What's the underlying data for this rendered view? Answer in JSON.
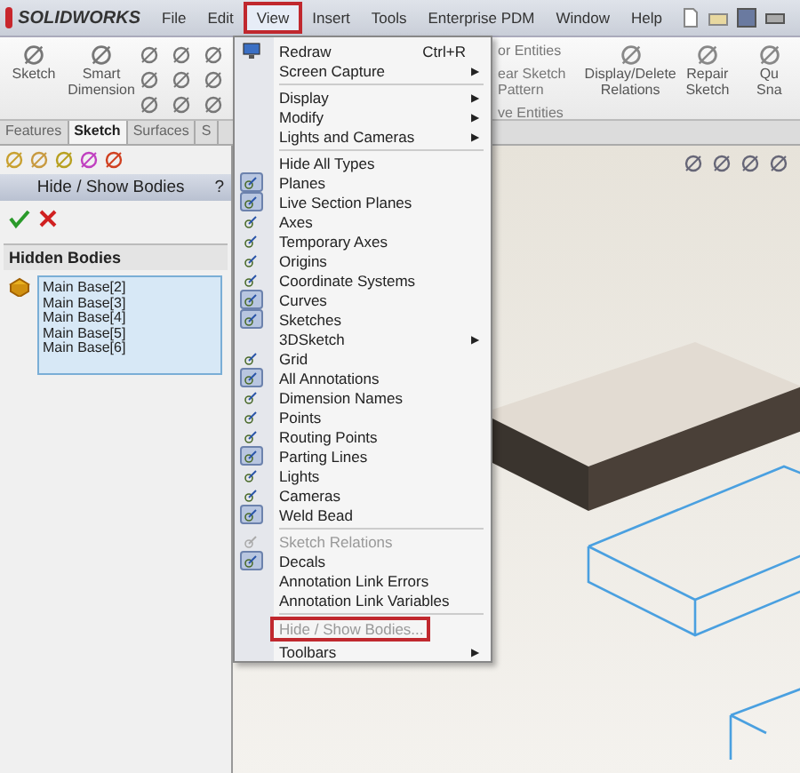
{
  "app": {
    "logo": "SOLIDWORKS"
  },
  "menubar": [
    {
      "label": "File",
      "selected": false
    },
    {
      "label": "Edit",
      "selected": false
    },
    {
      "label": "View",
      "selected": true
    },
    {
      "label": "Insert",
      "selected": false
    },
    {
      "label": "Tools",
      "selected": false
    },
    {
      "label": "Enterprise PDM",
      "selected": false
    },
    {
      "label": "Window",
      "selected": false
    },
    {
      "label": "Help",
      "selected": false
    }
  ],
  "ribbon": {
    "left": [
      {
        "label": "Sketch"
      },
      {
        "label": "Smart Dimension"
      }
    ],
    "partial": [
      "or Entities",
      "ear Sketch Pattern",
      "ve Entities"
    ],
    "right": [
      {
        "label": "Display/Delete Relations"
      },
      {
        "label": "Repair Sketch"
      },
      {
        "label": "Qu Sna"
      }
    ]
  },
  "tabs": [
    {
      "label": "Features",
      "selected": false
    },
    {
      "label": "Sketch",
      "selected": true
    },
    {
      "label": "Surfaces",
      "selected": false
    },
    {
      "label": "S",
      "selected": false
    }
  ],
  "property_manager": {
    "title": "Hide / Show Bodies",
    "help": "?",
    "group": {
      "title": "Hidden Bodies",
      "bodies": [
        "Main Base[2]",
        "Main Base[3]",
        "Main Base[4]",
        "Main Base[5]",
        "Main Base[6]"
      ]
    }
  },
  "view_menu": [
    {
      "kind": "icon_command",
      "label": "Redraw",
      "shortcut": "Ctrl+R"
    },
    {
      "kind": "submenu",
      "label": "Screen Capture",
      "arrow": "▶"
    },
    {
      "kind": "separator"
    },
    {
      "kind": "submenu",
      "label": "Display",
      "arrow": "▶"
    },
    {
      "kind": "submenu",
      "label": "Modify",
      "arrow": "▶"
    },
    {
      "kind": "submenu",
      "label": "Lights and Cameras",
      "arrow": "▶"
    },
    {
      "kind": "separator"
    },
    {
      "kind": "command",
      "label": "Hide All Types",
      "disabled": false
    },
    {
      "kind": "toggle",
      "label": "Planes",
      "checked": true,
      "disabled": false
    },
    {
      "kind": "toggle",
      "label": "Live Section Planes",
      "checked": true,
      "disabled": false
    },
    {
      "kind": "toggle",
      "label": "Axes",
      "checked": false,
      "disabled": false
    },
    {
      "kind": "toggle",
      "label": "Temporary Axes",
      "checked": false,
      "disabled": false
    },
    {
      "kind": "toggle",
      "label": "Origins",
      "checked": false,
      "disabled": false
    },
    {
      "kind": "toggle",
      "label": "Coordinate Systems",
      "checked": false,
      "disabled": false
    },
    {
      "kind": "toggle",
      "label": "Curves",
      "checked": true,
      "disabled": false
    },
    {
      "kind": "toggle",
      "label": "Sketches",
      "checked": true,
      "disabled": false
    },
    {
      "kind": "submenu",
      "label": "3DSketch",
      "arrow": "▶"
    },
    {
      "kind": "toggle",
      "label": "Grid",
      "checked": false,
      "disabled": false
    },
    {
      "kind": "toggle",
      "label": "All Annotations",
      "checked": true,
      "disabled": false
    },
    {
      "kind": "toggle",
      "label": "Dimension Names",
      "checked": false,
      "disabled": false
    },
    {
      "kind": "toggle",
      "label": "Points",
      "checked": false,
      "disabled": false
    },
    {
      "kind": "toggle",
      "label": "Routing Points",
      "checked": false,
      "disabled": false
    },
    {
      "kind": "toggle",
      "label": "Parting Lines",
      "checked": true,
      "disabled": false
    },
    {
      "kind": "toggle",
      "label": "Lights",
      "checked": false,
      "disabled": false
    },
    {
      "kind": "toggle",
      "label": "Cameras",
      "checked": false,
      "disabled": false
    },
    {
      "kind": "toggle",
      "label": "Weld Bead",
      "checked": true,
      "disabled": false
    },
    {
      "kind": "separator"
    },
    {
      "kind": "toggle",
      "label": "Sketch Relations",
      "checked": false,
      "disabled": true
    },
    {
      "kind": "toggle",
      "label": "Decals",
      "checked": true,
      "disabled": false
    },
    {
      "kind": "command",
      "label": "Annotation Link Errors",
      "disabled": false
    },
    {
      "kind": "command",
      "label": "Annotation Link Variables",
      "disabled": false
    },
    {
      "kind": "separator"
    },
    {
      "kind": "command",
      "label": "Hide / Show Bodies...",
      "disabled": true,
      "highlighted": true
    },
    {
      "kind": "submenu",
      "label": "Toolbars",
      "arrow": "▶"
    }
  ]
}
